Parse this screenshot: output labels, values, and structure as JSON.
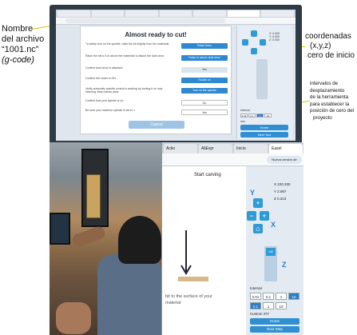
{
  "annotations": {
    "file_name": {
      "line1": "Nombre",
      "line2": "del archivo",
      "line3": "“1001.nc”",
      "line4": "(g-code)"
    },
    "coords": {
      "line1": "coordenadas",
      "line2": "(x,y,z)",
      "line3": "cero de inicio"
    },
    "intervals": {
      "line1": "intervalos de",
      "line2": "desplazamiento",
      "line3": "de la herramienta",
      "line4": "para establecer la",
      "line5": "posición de cero del",
      "line6": "proyecto"
    }
  },
  "top_screen": {
    "modal_title": "Almost ready to cut!",
    "rows": [
      {
        "text": "To safely turn on the spindle, raise the bit slightly from the materials.",
        "button": "Raise 5mm"
      },
      {
        "text": "Raise the bit to 5 to above the materials to attach the dust shoe.",
        "button": "Raise to above dust shoe"
      },
      {
        "text": "Confirm dust shoe is attached.",
        "button": "Yes"
      },
      {
        "text": "Confirm the router is ON.",
        "button": "Router on"
      },
      {
        "text": "Verify automatic spindle control is working by turning it on now. Warning: keep hands clear.",
        "button": "Turn on the spindle"
      },
      {
        "text": "Confirm that your spindle is on.",
        "button": "On"
      },
      {
        "text": "Be sure your machine spindle is set to 1",
        "button": "Yes"
      }
    ],
    "cancel_label": "Cancel",
    "coords": {
      "x": "X: 0.000",
      "y": "Y: 0.000",
      "z": "Z: 0.000"
    },
    "zero_label": "Interval",
    "increments": [
      "0.01",
      "0.1",
      "1",
      "10"
    ],
    "units": "mm",
    "home_label": "Home",
    "next_label": "Next Tool"
  },
  "bottom_screen": {
    "tabs": [
      "Actio",
      "AliExpr",
      "Inicio",
      "Easel"
    ],
    "account_label": "Nueva versión de",
    "start_carving": "Start carving",
    "material_line1": "bit to the surface of your",
    "material_line2": "material",
    "coords": {
      "x": "X 220.330",
      "y": "Y 2.987",
      "z": "Z 0.313"
    },
    "axis_labels": {
      "y": "Y",
      "x": "X",
      "z": "Z"
    },
    "lift_label": "Lift",
    "interval_label": "Interval",
    "increments_row1": [
      "0.01",
      "0.1",
      "1",
      "10"
    ],
    "increments_row2": [
      "0.1",
      "1",
      "10"
    ],
    "units_label": "Custom X/Y",
    "home_label": "Home",
    "next_label": "Next Step"
  },
  "colors": {
    "accent": "#2e89d0",
    "annotation_line": "#d6c400"
  }
}
